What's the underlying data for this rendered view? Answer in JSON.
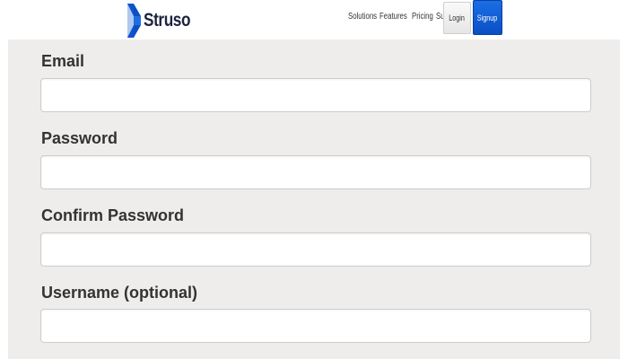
{
  "header": {
    "logo_text": "Struso",
    "brand_color": "#1f6fe0",
    "nav": {
      "solutions": "Solutions",
      "features": "Features",
      "pricing": "Pricing",
      "support": "Support"
    },
    "login_label": "Login",
    "signup_label": "Signup"
  },
  "form": {
    "fields": [
      {
        "label": "Email",
        "value": "",
        "placeholder": ""
      },
      {
        "label": "Password",
        "value": "",
        "placeholder": ""
      },
      {
        "label": "Confirm Password",
        "value": "",
        "placeholder": ""
      },
      {
        "label": "Username (optional)",
        "value": "",
        "placeholder": ""
      }
    ]
  }
}
